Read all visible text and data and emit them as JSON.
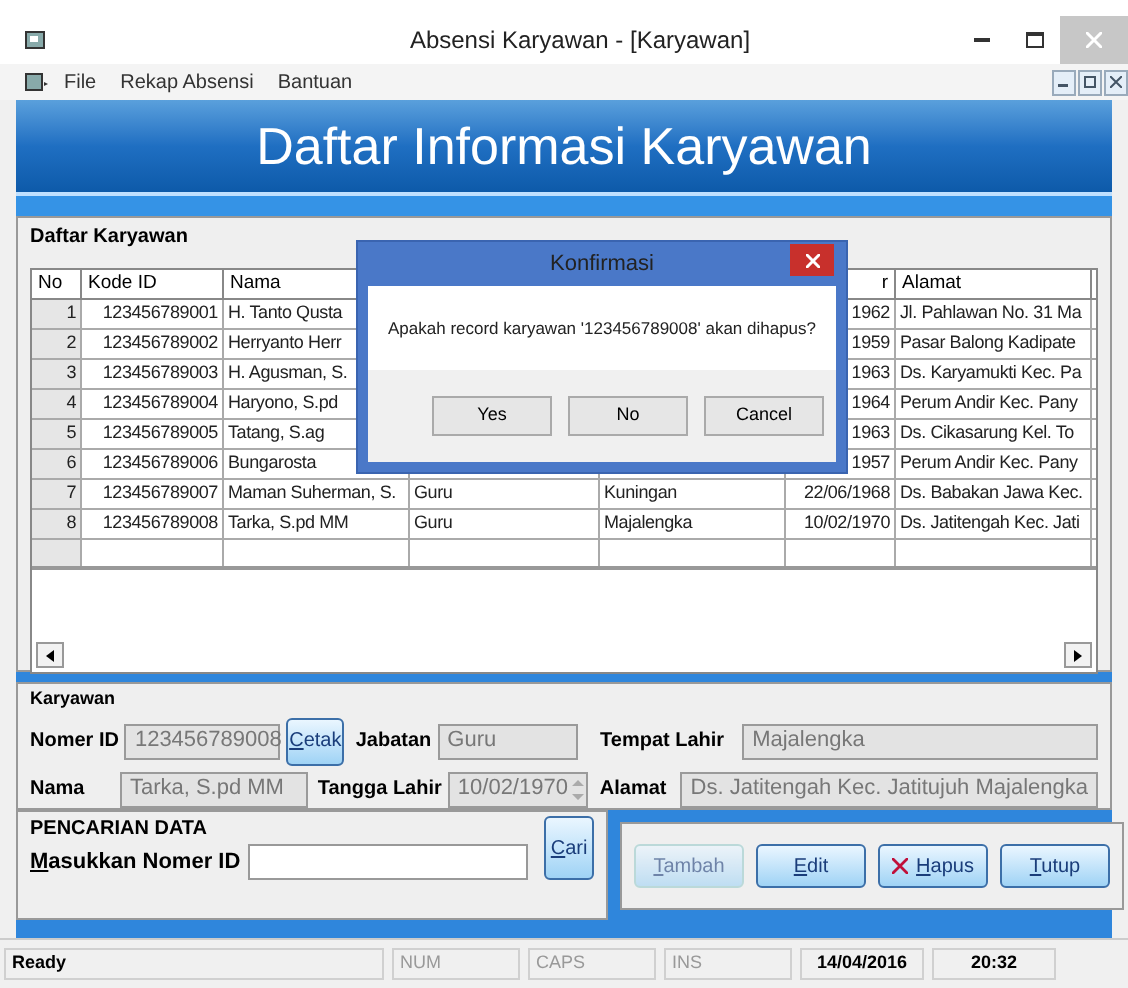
{
  "window": {
    "title": "Absensi Karyawan - [Karyawan]"
  },
  "menu": [
    "File",
    "Rekap Absensi",
    "Bantuan"
  ],
  "banner": {
    "title": "Daftar Informasi Karyawan"
  },
  "list_group": {
    "title": "Daftar Karyawan"
  },
  "table": {
    "columns": [
      "No",
      "Kode ID",
      "Nama",
      null,
      null,
      "r",
      "Alamat"
    ],
    "rows": [
      {
        "cells": [
          "1",
          "123456789001",
          "H. Tanto Qusta",
          null,
          null,
          "1962",
          "Jl. Pahlawan No. 31 Ma"
        ]
      },
      {
        "cells": [
          "2",
          "123456789002",
          "Herryanto Herr",
          null,
          null,
          "1959",
          "Pasar Balong Kadipate"
        ]
      },
      {
        "cells": [
          "3",
          "123456789003",
          "H. Agusman, S.",
          null,
          null,
          "1963",
          "Ds. Karyamukti Kec. Pa"
        ]
      },
      {
        "cells": [
          "4",
          "123456789004",
          "Haryono, S.pd",
          null,
          null,
          "1964",
          "Perum Andir Kec. Pany"
        ]
      },
      {
        "cells": [
          "5",
          "123456789005",
          "Tatang, S.ag",
          null,
          null,
          "1963",
          "Ds. Cikasarung Kel. To"
        ]
      },
      {
        "cells": [
          "6",
          "123456789006",
          "Bungarosta",
          null,
          null,
          "1957",
          "Perum Andir Kec. Pany"
        ]
      },
      {
        "cells": [
          "7",
          "123456789007",
          "Maman Suherman, S.",
          "Guru",
          "Kuningan",
          "22/06/1968",
          "Ds. Babakan Jawa Kec."
        ]
      },
      {
        "cells": [
          "8",
          "123456789008",
          "Tarka, S.pd MM",
          "Guru",
          "Majalengka",
          "10/02/1970",
          "Ds. Jatitengah Kec. Jati"
        ]
      }
    ]
  },
  "dialog": {
    "title": "Konfirmasi",
    "message": "Apakah record karyawan '123456789008' akan dihapus?",
    "buttons": [
      "Yes",
      "No",
      "Cancel"
    ]
  },
  "employee": {
    "title": "Karyawan",
    "nomer_id_label": "Nomer ID",
    "nomer_id": "123456789008",
    "print_button": "Cetak",
    "jabatan_label": "Jabatan",
    "jabatan": "Guru",
    "tempat_lahir_label": "Tempat Lahir",
    "tempat_lahir": "Majalengka",
    "nama_label": "Nama",
    "nama": "Tarka, S.pd MM",
    "tanggal_lahir_label": "Tangga Lahir",
    "tanggal_lahir": "10/02/1970",
    "alamat_label": "Alamat",
    "alamat": "Ds. Jatitengah Kec. Jatitujuh Majalengka"
  },
  "search": {
    "title": "PENCARIAN DATA",
    "label": "Masukkan Nomer ID",
    "button": "Cari"
  },
  "actions": [
    {
      "label": "Tambah",
      "kind": "plain",
      "disabled": true
    },
    {
      "label": "Edit",
      "kind": "plain",
      "disabled": false
    },
    {
      "label": "Hapus",
      "kind": "delete",
      "disabled": false
    },
    {
      "label": "Tutup",
      "kind": "plain",
      "disabled": false
    }
  ],
  "status_bar": [
    "Ready",
    "NUM",
    "CAPS",
    "INS",
    "14/04/2016",
    "20:32"
  ]
}
